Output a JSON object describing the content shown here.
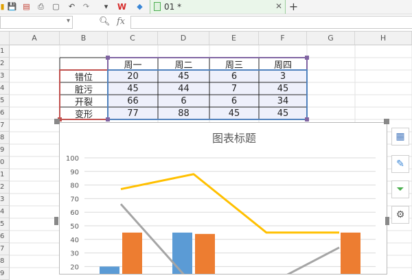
{
  "toolbar": {
    "icons": [
      "open-icon",
      "save-icon",
      "export-pdf-icon",
      "print-icon",
      "print-preview-icon",
      "undo-icon",
      "redo-icon",
      "dropdown-icon",
      "wps-logo",
      "cube-icon"
    ]
  },
  "tabs": [
    {
      "label": "01 *"
    }
  ],
  "formula_bar": {
    "fx_label": "fx",
    "value": ""
  },
  "columns": [
    "A",
    "B",
    "C",
    "D",
    "E",
    "F",
    "G",
    "H"
  ],
  "rows": [
    "1",
    "2",
    "3",
    "4",
    "5",
    "6",
    "7",
    "8",
    "9",
    "0",
    "1",
    "2",
    "3",
    "4",
    "5",
    "6",
    "7",
    "8",
    "9"
  ],
  "table": {
    "header": [
      "",
      "周一",
      "周二",
      "周三",
      "周四"
    ],
    "rows": [
      [
        "错位",
        "20",
        "45",
        "6",
        "3"
      ],
      [
        "脏污",
        "45",
        "44",
        "7",
        "45"
      ],
      [
        "开裂",
        "66",
        "6",
        "6",
        "34"
      ],
      [
        "变形",
        "77",
        "88",
        "45",
        "45"
      ]
    ]
  },
  "chart_data": {
    "type": "bar",
    "title": "图表标题",
    "categories": [
      "周一",
      "周二",
      "周三",
      "周四"
    ],
    "ylim": [
      0,
      100
    ],
    "yticks": [
      0,
      10,
      20,
      30,
      40,
      50,
      60,
      70,
      80,
      90,
      100
    ],
    "grid": true,
    "series": [
      {
        "name": "错位",
        "values": [
          20,
          45,
          6,
          3
        ],
        "kind": "bar",
        "color": "#5b9bd5"
      },
      {
        "name": "脏污",
        "values": [
          45,
          44,
          7,
          45
        ],
        "kind": "bar",
        "color": "#ed7d31"
      },
      {
        "name": "开裂",
        "values": [
          66,
          6,
          6,
          34
        ],
        "kind": "line",
        "color": "#a5a5a5"
      },
      {
        "name": "变形",
        "values": [
          77,
          88,
          45,
          45
        ],
        "kind": "line",
        "color": "#ffc000"
      }
    ]
  },
  "colors": {
    "accent_green": "#4caf50",
    "table_purple": "#8064a2",
    "table_blue": "#4f81bd",
    "table_red": "#c0504d"
  },
  "side_tools": [
    "chart-elements-icon",
    "chart-style-icon",
    "chart-filter-icon",
    "chart-settings-icon"
  ]
}
